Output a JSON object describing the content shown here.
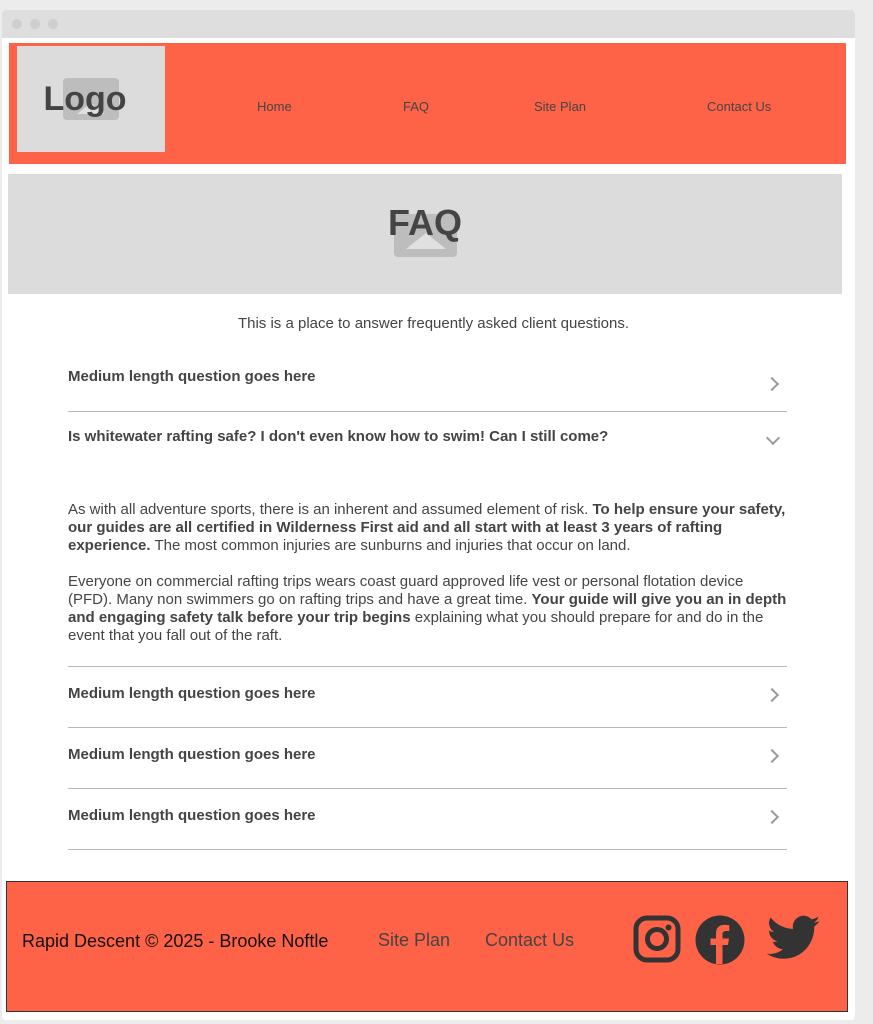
{
  "header": {
    "logo_text": "Logo",
    "nav": [
      "Home",
      "FAQ",
      "Site Plan",
      "Contact Us"
    ]
  },
  "hero": {
    "title": "FAQ"
  },
  "intro": "This is a place to answer frequently asked client questions.",
  "faq": {
    "items": [
      {
        "question": "Medium length question goes here",
        "expanded": false
      },
      {
        "question": "Is whitewater rafting safe? I don't even know how to swim! Can I still come?",
        "expanded": true,
        "answer": {
          "p1_a": "As with all adventure sports, there is an inherent and assumed element of risk. ",
          "p1_b": "To help ensure your safety, our guides are all certified in Wilderness First aid and all start with at least 3 years of rafting experience.",
          "p1_c": " The most common injuries are sunburns and injuries that occur on land.",
          "p2_a": "Everyone on commercial rafting trips wears coast guard approved life vest or personal flotation device (PFD). Many non swimmers go on rafting trips and have a great time. ",
          "p2_b": "Your guide will give you an in depth and engaging safety talk before your trip begins",
          "p2_c": " explaining what you should prepare for and do in the event that you fall out of the raft."
        }
      },
      {
        "question": "Medium length question goes here",
        "expanded": false
      },
      {
        "question": "Medium length question goes here",
        "expanded": false
      },
      {
        "question": "Medium length question goes here",
        "expanded": false
      }
    ]
  },
  "footer": {
    "copyright": "Rapid Descent © 2025 - Brooke Noftle",
    "links": [
      "Site Plan",
      "Contact Us"
    ],
    "social_icons": [
      "instagram-icon",
      "facebook-icon",
      "twitter-icon"
    ]
  },
  "colors": {
    "accent": "#ff6347",
    "placeholder": "#dcdcdc",
    "text": "#444444"
  }
}
